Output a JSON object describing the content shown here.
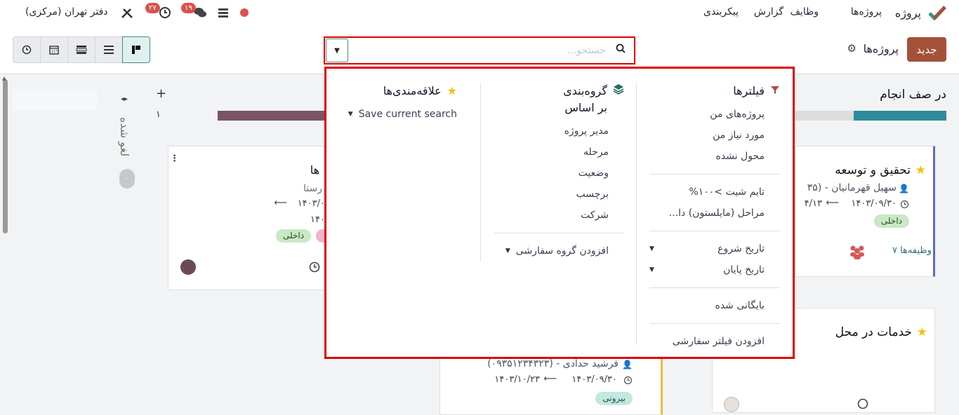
{
  "nav": {
    "app_title": "پروژه",
    "menu": [
      "پروژه‌ها",
      "وظایف",
      "گزارش",
      "پیکربندی"
    ],
    "company": "دفتر تهران (مرکزی)",
    "badge_activity": "۲۷",
    "badge_messages": "۱۹",
    "status_color": "#d9534f"
  },
  "control": {
    "new_label": "جدید",
    "breadcrumb": "پروژه‌ها",
    "search_placeholder": "جستجو...",
    "views": [
      "clock-icon",
      "calendar-icon",
      "gantt-icon",
      "list-icon",
      "kanban-icon"
    ],
    "active_view": "kanban-icon"
  },
  "board": {
    "col_right_title": "در صف انجام",
    "col_mid_count": "۱",
    "col_folded_title": "لغو شده",
    "col_folded_count": "۰",
    "card1": {
      "title": "تحقیق و توسعه",
      "manager": "سهیل قهرمانیان - (۳۵",
      "date_from": "۱۴۰۳/۰۹/۳۰",
      "date_to": "۴/۱۳",
      "tag": "داخلی",
      "tasks": "۷ وظیفه‌ها"
    },
    "card2": {
      "title": "خدمات در محل"
    },
    "card3": {
      "title": "ها",
      "subtitle": "رستا",
      "date1": "۱۴۰۳/۰",
      "date2": "۱۴۰",
      "tag": "داخلی"
    },
    "card4": {
      "manager": "فرشید حدادی - (۰۹۳۵۱۲۳۴۳۲۳)",
      "date_from": "۱۴۰۳/۰۹/۳۰",
      "date_to": "۱۴۰۳/۱۰/۲۳",
      "tag": "بیرونی"
    }
  },
  "dropdown": {
    "filters": {
      "title": "فیلترها",
      "group1": [
        "پروژه‌های من",
        "مورد نیاز من",
        "محول نشده"
      ],
      "group2": [
        "تایم شیت >۱۰۰%",
        "مراحل (مایلستون) دا..."
      ],
      "group3": [
        "تاریخ شروع",
        "تاریخ پایان"
      ],
      "group4": [
        "بایگانی شده"
      ],
      "custom": "افزودن فیلتر سفارشی"
    },
    "groupby": {
      "title": "گروه‌بندی بر اساس",
      "items": [
        "مدیر پروژه",
        "مرحله",
        "وضعیت",
        "برچسب",
        "شرکت"
      ],
      "custom": "افزودن گروه سفارشی"
    },
    "favorites": {
      "title": "علاقه‌مندی‌ها",
      "save": "Save current search"
    }
  }
}
